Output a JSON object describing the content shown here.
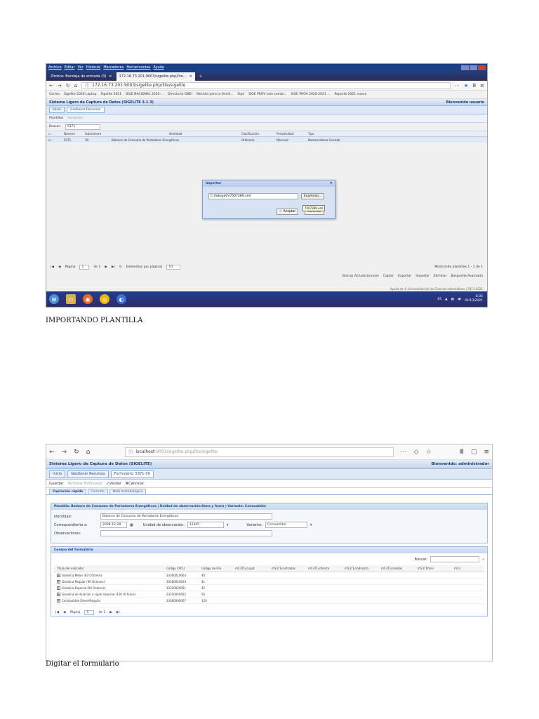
{
  "shot1": {
    "menu": [
      "Archivo",
      "Editar",
      "Ver",
      "Historial",
      "Marcadores",
      "Herramientas",
      "Ayuda"
    ],
    "tabs": [
      {
        "label": "Zimbra: Bandeja de entrada (3)"
      },
      {
        "label": "172.16.73.201:9003/sigelite.php/lite..."
      }
    ],
    "url": "172.16.73.201:9003/sigelite.php/lite/sigelite",
    "bookmarks": [
      "Correo",
      "Sigelite 2020 Laptop",
      "Sigelite 2021",
      "SIGE NACIONAL 2020-...",
      "Directorio ONEI",
      "Mochila para la famili...",
      "Sipe",
      "SIGE PROV solo cambi...",
      "SIGE PROV 2020-2021 ...",
      "Reporte 2021 nuevo"
    ],
    "app_title": "Sistema Ligero de Captura de Datos (SIGELITE 3.1.3)",
    "welcome": "Bienvenido usuario",
    "app_tabs": [
      "Inicio",
      "Gestionar Recursos"
    ],
    "toolbar": [
      "Plantillas",
      "Versiones"
    ],
    "search_label": "Buscar:",
    "search_value": "5371",
    "grid_headers": [
      "Número",
      "Subnúmero",
      "Identidad",
      "Clasificación",
      "Periodicidad",
      "Tipo"
    ],
    "grid_row": [
      "5371",
      "39",
      "Balance de Consumo de Portadores Energéticos",
      "Ordinario",
      "Mensual",
      "Nomenclatura Cerrada"
    ],
    "dialog": {
      "title": "Importar",
      "field": "C:\\fakepath\\7507389.xml",
      "browse": "Examinar...",
      "accept": "Aceptar",
      "cancel": "Cancelar",
      "tooltip": "7507389.xml"
    },
    "pager": {
      "page_label": "Página",
      "page": "1",
      "of": "de 1",
      "per_page_label": "Elementos por páginas",
      "per_page": "10",
      "showing": "Mostrando plantillas 1 - 1 de 1"
    },
    "actions": [
      "Buscar Actualizaciones",
      "Captar",
      "Exportar",
      "Importar",
      "Eliminar",
      "Búsqueda Avanzada"
    ],
    "footer": "Ayuda de © Universidad de las Ciencias Informáticas | 2011-2021",
    "tray": {
      "lang": "ES",
      "time": "8:35",
      "date": "05/10/2021"
    }
  },
  "caption1": "IMPORTANDO PLANTILLA",
  "shot2": {
    "url_host": "localhost",
    "url_rest": ":9003/sigelite.php/lite/sigelite",
    "app_title": "Sistema Ligero de Captura de Datos (SIGELITE)",
    "welcome": "Bienvenido: administrador",
    "app_tabs": [
      "Inicio",
      "Gestionar Recursos",
      "Formulario: 5371-39"
    ],
    "toolbar": [
      "Guardar",
      "Terminar formulario",
      "Validar",
      "Cancelar"
    ],
    "subtabs": [
      "Captación rápida",
      "Formato",
      "Nota metodológica"
    ],
    "plantilla_title": "Plantilla: Balance de Consumo de Portadores Energéticos | Unidad de observación:llena y fuera | Variante: Consumidor",
    "identidad_label": "Identidad:",
    "identidad_value": "Balance de Consumo de Portadores Energéticos",
    "corresp_label": "Correspondiente a:",
    "corresp_value": "2008-12-28",
    "unidad_label": "Unidad de observación:",
    "unidad_value": "12345",
    "variante_label": "Variante:",
    "variante_value": "Consumidor",
    "obs_label": "Observaciones:",
    "cuerpo_title": "Cuerpo del formulario",
    "buscar_label": "Buscar:",
    "table_headers": [
      "Título del indicador",
      "Código CPCU",
      "Código de Fila",
      "m5371ccupat",
      "m5371centradas",
      "m5371cdirecto",
      "m5371cindirecto",
      "m5371csalidas",
      "m5371final",
      "m53"
    ],
    "rows": [
      {
        "name": "Gasolina Motor (83 Octanos)",
        "cpcu": "33300010003",
        "fila": "40"
      },
      {
        "name": "Gasolina Regular (90 Octanos)",
        "cpcu": "33300010004",
        "fila": "41"
      },
      {
        "name": "Gasolina Especial (94 Octanos)",
        "cpcu": "33310020001",
        "fila": "42"
      },
      {
        "name": "Gasolina de Aviación a súper especial (100 Octanos)",
        "cpcu": "33310040002",
        "fila": "50"
      },
      {
        "name": "Combustible Diesel/Regular",
        "cpcu": "33360000007",
        "fila": "120"
      }
    ],
    "pager_label": "Página",
    "pager_page": "1",
    "pager_of": "de 1"
  },
  "caption2": "Digitar el formulario"
}
